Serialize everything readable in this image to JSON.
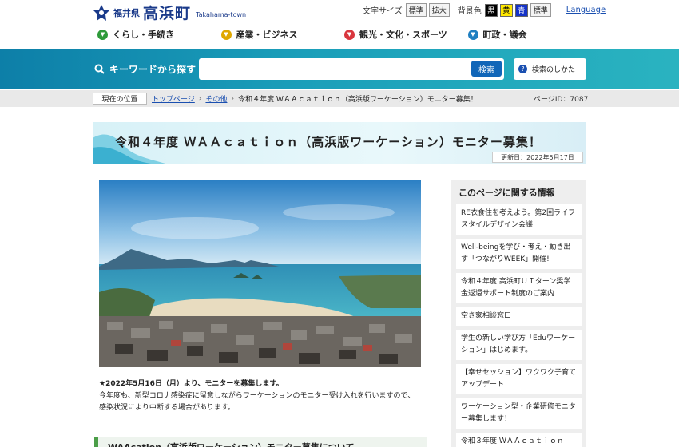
{
  "header": {
    "pref": "福井県",
    "town": "高浜町",
    "town_en": "Takahama-town"
  },
  "tools": {
    "font_size_label": "文字サイズ",
    "font_standard": "標準",
    "font_large": "拡大",
    "bg_label": "背景色",
    "bg_black": "黒",
    "bg_yellow": "黄",
    "bg_blue": "青",
    "bg_standard": "標準",
    "language": "Language"
  },
  "gnav": [
    {
      "label": "くらし・手続き",
      "color": "#2e9a3a"
    },
    {
      "label": "産業・ビジネス",
      "color": "#e0a800"
    },
    {
      "label": "観光・文化・スポーツ",
      "color": "#d9363e"
    },
    {
      "label": "町政・議会",
      "color": "#1f7fc1"
    }
  ],
  "search": {
    "title": "キーワードから探す",
    "button": "検索",
    "howto": "検索のしかた"
  },
  "breadcrumb": {
    "here": "現在の位置",
    "items": [
      "トップページ",
      "その他"
    ],
    "current": "令和４年度 ＷＡＡｃａｔｉｏｎ（高浜版ワーケーション）モニター募集！",
    "page_id": "ページID：7087"
  },
  "page": {
    "title": "令和４年度 ＷＡＡｃａｔｉｏｎ（高浜版ワーケーション）モニター募集！",
    "updated": "更新日：2022年5月17日",
    "notice_strong": "★2022年5月16日（月）より、モニターを募集します。",
    "notice_line1": "今年度も、新型コロナ感染症に留意しながらワーケーションのモニター受け入れを行いますので、",
    "notice_line2": "感染状況により中断する場合があります。",
    "section_head": "WAAcation（高浜版ワーケーション）モニター募集について"
  },
  "sidebar": {
    "title": "このページに関する情報",
    "items": [
      "RE衣食住を考えよう。第2回ライフスタイルデザイン会議",
      "Well-beingを学び・考え・動き出す「つながりWEEK」開催!",
      "令和４年度 高浜町ＵＩターン奨学金返還サポート制度のご案内",
      "空き家相談窓口",
      "学生の新しい学び方「Eduワーケーション」はじめます。",
      "【幸せセッション】ワクワク子育てアップデート",
      "ワーケーション型・企業研修モニター募集します！",
      "令和３年度 ＷＡＡｃａｔｉｏｎ"
    ]
  }
}
